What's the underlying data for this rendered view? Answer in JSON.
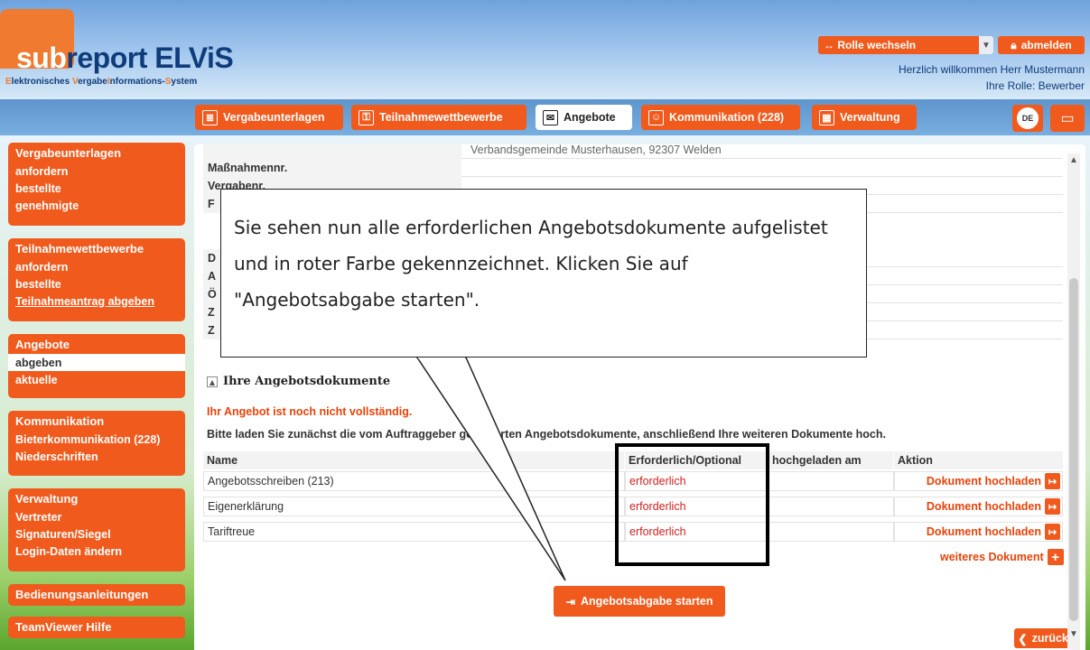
{
  "brand": {
    "sub": "sub",
    "rest": "report ELViS",
    "slogan_parts": [
      "E",
      "lektronisches ",
      "V",
      "ergabe",
      "I",
      "nformations-",
      "S",
      "ystem"
    ]
  },
  "header": {
    "role_switch": "Rolle wechseln",
    "logout": "abmelden",
    "welcome": "Herzlich willkommen Herr Mustermann",
    "role": "Ihre Rolle: Bewerber"
  },
  "tabs": [
    {
      "label": "Vergabeunterlagen",
      "icon": "document-icon"
    },
    {
      "label": "Teilnahmewettbewerbe",
      "icon": "certificate-icon"
    },
    {
      "label": "Angebote",
      "icon": "envelope-icon"
    },
    {
      "label": "Kommunikation (228)",
      "icon": "user-chat-icon"
    },
    {
      "label": "Verwaltung",
      "icon": "calendar-grid-icon"
    }
  ],
  "lang": "DE",
  "sidebar": {
    "vergabeunterlagen": {
      "title": "Vergabeunterlagen",
      "items": [
        "anfordern",
        "bestellte",
        "genehmigte"
      ]
    },
    "teilnahme": {
      "title": "Teilnahmewettbewerbe",
      "items": [
        "anfordern",
        "bestellte",
        "Teilnahmeantrag abgeben"
      ]
    },
    "angebote": {
      "title": "Angebote",
      "items": [
        "abgeben",
        "aktuelle"
      ]
    },
    "kommunikation": {
      "title": "Kommunikation",
      "items": [
        "Bieterkommunikation (228)",
        "Niederschriften"
      ]
    },
    "verwaltung": {
      "title": "Verwaltung",
      "items": [
        "Vertreter",
        "Signaturen/Siegel",
        "Login-Daten ändern"
      ]
    },
    "anleitungen": {
      "title": "Bedienungsanleitungen"
    },
    "teamviewer": {
      "title": "TeamViewer Hilfe"
    }
  },
  "info": {
    "row0_value": "Verbandsgemeinde Musterhausen, 92307 Welden",
    "labels": [
      "Maßnahmennr.",
      "Vergabenr.",
      "F",
      "",
      "D",
      "A",
      "Ö",
      "Z",
      "Z"
    ]
  },
  "docs": {
    "section_title": "Ihre Angebotsdokumente",
    "warning": "Ihr Angebot ist noch nicht vollständig.",
    "instruction": "Bitte laden Sie zunächst die vom Auftraggeber geforderten Angebotsdokumente, anschließend Ihre weiteren Dokumente hoch.",
    "columns": {
      "name": "Name",
      "req": "Erforderlich/Optional",
      "uploaded": "hochgeladen am",
      "action": "Aktion"
    },
    "rows": [
      {
        "name": "Angebotsschreiben (213)",
        "req": "erforderlich",
        "uploaded": "",
        "action": "Dokument hochladen"
      },
      {
        "name": "Eigenerklärung",
        "req": "erforderlich",
        "uploaded": "",
        "action": "Dokument hochladen"
      },
      {
        "name": "Tariftreue",
        "req": "erforderlich",
        "uploaded": "",
        "action": "Dokument hochladen"
      }
    ],
    "more": "weiteres Dokument",
    "start": "Angebotsabgabe starten",
    "back": "zurück"
  },
  "tooltip": "Sie sehen nun alle erforderlichen Angebotsdokumente aufgelistet und in roter Farbe gekennzeichnet. Klicken Sie auf \"Angebotsabgabe starten\".",
  "colors": {
    "accent": "#f05a1c",
    "brand_blue": "#0f3c7a",
    "required": "#d21f1f"
  }
}
